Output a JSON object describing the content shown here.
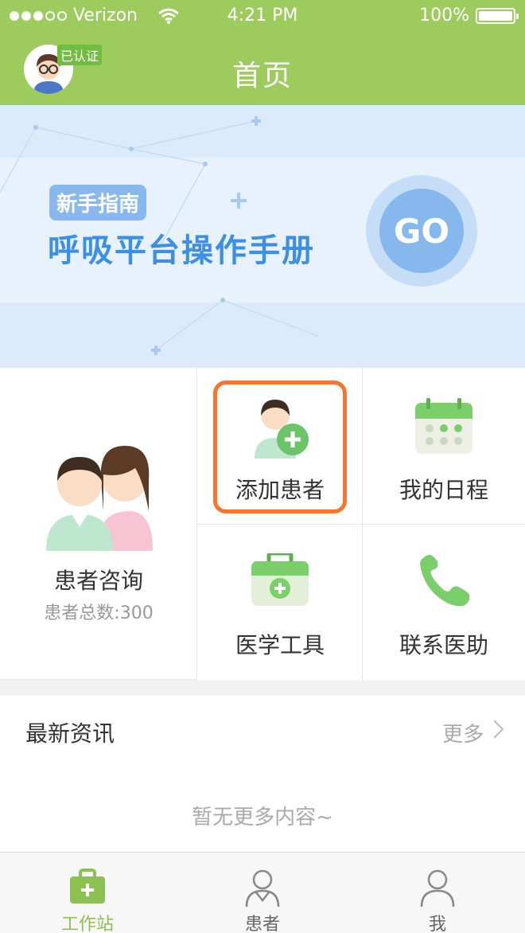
{
  "status_bar": {
    "carrier": "Verizon",
    "time": "4:21 PM",
    "battery": "100%"
  },
  "header": {
    "title": "首页",
    "verified_badge": "已认证"
  },
  "banner": {
    "tag": "新手指南",
    "headline": "呼吸平台操作手册",
    "go_label": "GO"
  },
  "grid": {
    "consult": {
      "label": "患者咨询",
      "sub": "患者总数:300"
    },
    "add_patient": {
      "label": "添加患者"
    },
    "schedule": {
      "label": "我的日程"
    },
    "medical_tools": {
      "label": "医学工具"
    },
    "contact_assistant": {
      "label": "联系医助"
    }
  },
  "news": {
    "title": "最新资讯",
    "more": "更多",
    "empty": "暂无更多内容~"
  },
  "tabbar": {
    "items": [
      {
        "label": "工作站",
        "icon": "medical-kit-icon",
        "active": true
      },
      {
        "label": "患者",
        "icon": "patients-icon",
        "active": false
      },
      {
        "label": "我",
        "icon": "person-icon",
        "active": false
      }
    ]
  },
  "colors": {
    "brand_green": "#9ecb5e",
    "highlight_orange": "#f7752c",
    "banner_blue": "#3c8fe4"
  }
}
